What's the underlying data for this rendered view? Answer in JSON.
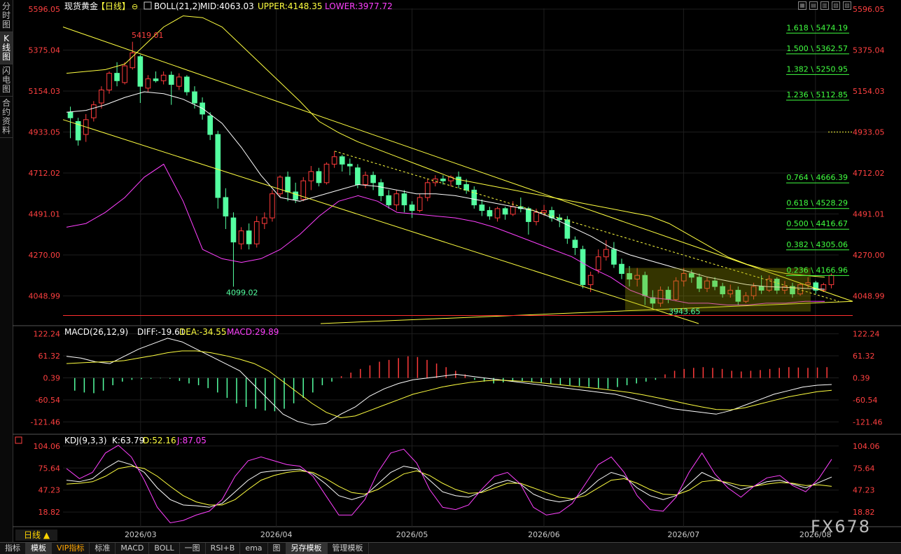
{
  "sidebar": {
    "tabs": [
      {
        "label": "分时图",
        "active": false
      },
      {
        "label": "K线图",
        "active": true
      },
      {
        "label": "闪电图",
        "active": false
      },
      {
        "label": "合约资料",
        "active": false
      }
    ]
  },
  "header": {
    "title": "现货黄金",
    "period": "【日线】",
    "lock_glyph": "⊖",
    "boll_label": "BOLL(21,2)",
    "mid_text": "MID:4063.03",
    "upper_text": "UPPER:4148.35",
    "lower_text": "LOWER:3977.72"
  },
  "macd_header": {
    "label": "MACD(26,12,9)",
    "diff": "DIFF:-19.61",
    "dea": "DEA:-34.55",
    "macd": "MACD:29.89"
  },
  "kdj_header": {
    "label": "KDJ(9,3,3)",
    "k": "K:63.79",
    "d": "D:52.16",
    "j": "J:87.05"
  },
  "period_button": "日线 ▲",
  "watermark": "FX678",
  "bottom_tabs": [
    {
      "label": "指标",
      "active": false,
      "vip": false
    },
    {
      "label": "模板",
      "active": true,
      "vip": false
    },
    {
      "label": "VIP指标",
      "active": false,
      "vip": true
    },
    {
      "label": "标准",
      "active": false,
      "vip": false
    },
    {
      "label": "MACD",
      "active": false,
      "vip": false
    },
    {
      "label": "BOLL",
      "active": false,
      "vip": false
    },
    {
      "label": "一图",
      "active": false,
      "vip": false
    },
    {
      "label": "RSI+B",
      "active": false,
      "vip": false
    },
    {
      "label": "ema",
      "active": false,
      "vip": false
    },
    {
      "label": "图",
      "active": false,
      "vip": false
    },
    {
      "label": "另存模板",
      "active": true,
      "vip": false
    },
    {
      "label": "管理模板",
      "active": false,
      "vip": false
    }
  ],
  "colors": {
    "up": "#ff3b3b",
    "down": "#54ffa0",
    "boll_mid": "#ffffff",
    "boll_upper": "#ffff40",
    "boll_lower": "#ff40ff",
    "channel": "#ffff40",
    "grid": "#1e1e1e",
    "axis": "#ff4040",
    "fib": "#40ff40"
  },
  "chart_data": [
    {
      "type": "candlestick",
      "title": "现货黄金【日线】",
      "y_ticks": [
        "5596.05",
        "5375.04",
        "5154.03",
        "4933.05",
        "4712.02",
        "4491.01",
        "4270.00",
        "4048.99"
      ],
      "ylim": [
        3900,
        5600
      ],
      "x_ticks": [
        "2026/03",
        "2026/04",
        "2026/05",
        "2026/06",
        "2026/07",
        "2026/08"
      ],
      "candles": [
        [
          5040,
          5010,
          5070,
          4900
        ],
        [
          4990,
          4890,
          5010,
          4860
        ],
        [
          4920,
          5000,
          5030,
          4880
        ],
        [
          5010,
          5080,
          5100,
          4990
        ],
        [
          5090,
          5160,
          5180,
          5060
        ],
        [
          5160,
          5250,
          5260,
          5140
        ],
        [
          5250,
          5210,
          5310,
          5180
        ],
        [
          5200,
          5290,
          5310,
          5190
        ],
        [
          5280,
          5360,
          5420,
          5270
        ],
        [
          5340,
          5180,
          5350,
          5090
        ],
        [
          5170,
          5220,
          5240,
          5150
        ],
        [
          5220,
          5210,
          5260,
          5200
        ],
        [
          5210,
          5240,
          5260,
          5190
        ],
        [
          5240,
          5190,
          5260,
          5080
        ],
        [
          5180,
          5230,
          5250,
          5160
        ],
        [
          5230,
          5150,
          5240,
          5130
        ],
        [
          5150,
          5090,
          5180,
          5060
        ],
        [
          5090,
          5030,
          5120,
          5000
        ],
        [
          5020,
          4920,
          5040,
          4890
        ],
        [
          4920,
          4580,
          4940,
          4520
        ],
        [
          4580,
          4480,
          4630,
          4410
        ],
        [
          4470,
          4340,
          4500,
          4099
        ],
        [
          4330,
          4400,
          4420,
          4300
        ],
        [
          4400,
          4330,
          4440,
          4300
        ],
        [
          4330,
          4450,
          4480,
          4310
        ],
        [
          4440,
          4470,
          4500,
          4410
        ],
        [
          4470,
          4600,
          4620,
          4450
        ],
        [
          4600,
          4690,
          4700,
          4580
        ],
        [
          4690,
          4610,
          4720,
          4560
        ],
        [
          4610,
          4570,
          4660,
          4550
        ],
        [
          4570,
          4670,
          4690,
          4560
        ],
        [
          4670,
          4720,
          4750,
          4620
        ],
        [
          4720,
          4660,
          4740,
          4640
        ],
        [
          4660,
          4760,
          4770,
          4650
        ],
        [
          4760,
          4800,
          4830,
          4740
        ],
        [
          4800,
          4760,
          4810,
          4720
        ],
        [
          4760,
          4750,
          4790,
          4700
        ],
        [
          4740,
          4650,
          4760,
          4630
        ],
        [
          4650,
          4700,
          4720,
          4630
        ],
        [
          4700,
          4660,
          4720,
          4620
        ],
        [
          4660,
          4590,
          4680,
          4560
        ],
        [
          4590,
          4540,
          4620,
          4520
        ],
        [
          4540,
          4600,
          4620,
          4510
        ],
        [
          4600,
          4540,
          4620,
          4500
        ],
        [
          4540,
          4510,
          4560,
          4470
        ],
        [
          4510,
          4580,
          4600,
          4500
        ],
        [
          4580,
          4660,
          4680,
          4560
        ],
        [
          4660,
          4680,
          4700,
          4640
        ],
        [
          4680,
          4670,
          4700,
          4650
        ],
        [
          4670,
          4690,
          4700,
          4640
        ],
        [
          4690,
          4650,
          4720,
          4630
        ],
        [
          4650,
          4620,
          4680,
          4600
        ],
        [
          4620,
          4540,
          4640,
          4520
        ],
        [
          4540,
          4510,
          4570,
          4480
        ],
        [
          4510,
          4480,
          4530,
          4460
        ],
        [
          4470,
          4520,
          4530,
          4450
        ],
        [
          4520,
          4490,
          4530,
          4460
        ],
        [
          4490,
          4530,
          4560,
          4480
        ],
        [
          4530,
          4520,
          4580,
          4500
        ],
        [
          4520,
          4450,
          4530,
          4380
        ],
        [
          4450,
          4500,
          4520,
          4430
        ],
        [
          4500,
          4510,
          4540,
          4480
        ],
        [
          4510,
          4470,
          4530,
          4450
        ],
        [
          4470,
          4460,
          4490,
          4420
        ],
        [
          4460,
          4360,
          4480,
          4330
        ],
        [
          4350,
          4310,
          4370,
          4270
        ],
        [
          4300,
          4110,
          4320,
          4090
        ],
        [
          4110,
          4160,
          4180,
          4070
        ],
        [
          4190,
          4260,
          4300,
          4170
        ],
        [
          4260,
          4300,
          4350,
          4240
        ],
        [
          4300,
          4220,
          4340,
          4200
        ],
        [
          4220,
          4170,
          4250,
          4140
        ],
        [
          4170,
          4140,
          4210,
          4100
        ],
        [
          4140,
          4160,
          4200,
          4100
        ],
        [
          4160,
          4050,
          4180,
          4000
        ],
        [
          4040,
          4010,
          4080,
          3980
        ],
        [
          4010,
          4080,
          4100,
          3990
        ],
        [
          4080,
          4030,
          4100,
          4010
        ],
        [
          4030,
          4130,
          4150,
          4020
        ],
        [
          4130,
          4170,
          4200,
          4100
        ],
        [
          4170,
          4150,
          4190,
          4120
        ],
        [
          4150,
          4090,
          4170,
          4070
        ],
        [
          4090,
          4130,
          4150,
          4070
        ],
        [
          4130,
          4100,
          4150,
          4080
        ],
        [
          4100,
          4060,
          4120,
          4040
        ],
        [
          4060,
          4080,
          4110,
          4040
        ],
        [
          4080,
          4020,
          4100,
          4000
        ],
        [
          4020,
          4050,
          4070,
          4010
        ],
        [
          4050,
          4100,
          4120,
          4030
        ],
        [
          4100,
          4080,
          4160,
          4060
        ],
        [
          4080,
          4140,
          4160,
          4070
        ],
        [
          4140,
          4080,
          4150,
          4060
        ],
        [
          4080,
          4100,
          4130,
          4060
        ],
        [
          4100,
          4060,
          4120,
          4040
        ],
        [
          4060,
          4110,
          4120,
          4050
        ],
        [
          4110,
          4120,
          4150,
          4090
        ],
        [
          4120,
          4080,
          4130,
          4060
        ],
        [
          4080,
          4110,
          4120,
          4070
        ],
        [
          4110,
          4160,
          4170,
          4090
        ]
      ],
      "boll_upper": [
        5250,
        5260,
        5270,
        5300,
        5400,
        5500,
        5560,
        5550,
        5500,
        5400,
        5300,
        5200,
        5100,
        4990,
        4930,
        4880,
        4840,
        4800,
        4760,
        4720,
        4680,
        4660,
        4640,
        4620,
        4600,
        4580,
        4560,
        4540,
        4520,
        4500,
        4480,
        4440,
        4380,
        4320,
        4260,
        4220,
        4190,
        4170,
        4160,
        4150
      ],
      "boll_mid": [
        5040,
        5050,
        5080,
        5120,
        5150,
        5140,
        5110,
        5060,
        4980,
        4850,
        4700,
        4580,
        4560,
        4590,
        4620,
        4650,
        4640,
        4620,
        4600,
        4600,
        4590,
        4570,
        4550,
        4530,
        4510,
        4470,
        4420,
        4370,
        4310,
        4270,
        4240,
        4210,
        4180,
        4150,
        4130,
        4110,
        4100,
        4095,
        4090,
        4085
      ],
      "boll_lower": [
        4420,
        4440,
        4500,
        4580,
        4690,
        4760,
        4560,
        4300,
        4250,
        4230,
        4250,
        4300,
        4380,
        4480,
        4560,
        4590,
        4560,
        4500,
        4490,
        4480,
        4470,
        4450,
        4420,
        4380,
        4340,
        4300,
        4260,
        4200,
        4150,
        4080,
        4040,
        4030,
        4010,
        4010,
        4000,
        4000,
        4010,
        4010,
        4020,
        4020
      ],
      "fib_levels": [
        {
          "label": "1.618 \\ 5474.19",
          "value": 5474.19
        },
        {
          "label": "1.500 \\ 5362.57",
          "value": 5362.57
        },
        {
          "label": "1.382 \\ 5250.95",
          "value": 5250.95
        },
        {
          "label": "1.236 \\ 5112.85",
          "value": 5112.85
        },
        {
          "label": "0.764 \\ 4666.39",
          "value": 4666.39
        },
        {
          "label": "0.618 \\ 4528.29",
          "value": 4528.29
        },
        {
          "label": "0.500 \\ 4416.67",
          "value": 4416.67
        },
        {
          "label": "0.382 \\ 4305.06",
          "value": 4305.06
        },
        {
          "label": "0.236 \\ 4166.96",
          "value": 4166.96
        }
      ],
      "annotations": [
        {
          "text": "5419.01",
          "value": 5419.01
        },
        {
          "text": "4099.02",
          "value": 4099.02
        },
        {
          "text": "3943.65",
          "value": 3943.65
        }
      ],
      "support_line_value": 3943.65
    },
    {
      "type": "macd",
      "y_ticks": [
        "122.24",
        "61.32",
        "0.39",
        "-60.54",
        "-121.46"
      ],
      "ylim": [
        -140,
        135
      ],
      "diff": [
        60,
        55,
        45,
        40,
        60,
        80,
        95,
        110,
        100,
        80,
        60,
        40,
        20,
        -20,
        -60,
        -100,
        -120,
        -130,
        -125,
        -100,
        -80,
        -50,
        -30,
        -15,
        -5,
        0,
        5,
        10,
        5,
        0,
        -5,
        -10,
        -15,
        -20,
        -25,
        -30,
        -35,
        -40,
        -45,
        -55,
        -65,
        -75,
        -85,
        -90,
        -95,
        -100,
        -90,
        -75,
        -60,
        -45,
        -35,
        -25,
        -20,
        -18
      ],
      "dea": [
        40,
        42,
        44,
        45,
        48,
        55,
        62,
        70,
        75,
        75,
        70,
        62,
        52,
        40,
        20,
        -10,
        -40,
        -70,
        -95,
        -110,
        -105,
        -90,
        -75,
        -60,
        -45,
        -35,
        -25,
        -18,
        -12,
        -8,
        -6,
        -8,
        -10,
        -14,
        -18,
        -22,
        -26,
        -30,
        -35,
        -40,
        -47,
        -55,
        -63,
        -72,
        -80,
        -87,
        -88,
        -82,
        -72,
        -62,
        -52,
        -45,
        -38,
        -34
      ],
      "hist": [
        -35,
        -40,
        -42,
        -35,
        -20,
        -10,
        -5,
        -3,
        -2,
        -1,
        -2,
        -8,
        -15,
        -20,
        -28,
        -40,
        -55,
        -70,
        -80,
        -85,
        -90,
        -92,
        -85,
        -70,
        -55,
        -40,
        -20,
        -10,
        5,
        15,
        25,
        35,
        45,
        50,
        55,
        60,
        58,
        50,
        40,
        30,
        20,
        10,
        -5,
        -10,
        -15,
        -12,
        -10,
        -8,
        -10,
        -12,
        -15,
        -18,
        -20,
        -22,
        -25,
        -28,
        -30,
        -25,
        -20,
        -15,
        -10,
        -5,
        10,
        20,
        25,
        28,
        30,
        28,
        25,
        20,
        18,
        20,
        22,
        25,
        28,
        30,
        29,
        28,
        29,
        30
      ]
    },
    {
      "type": "kdj",
      "y_ticks": [
        "104.06",
        "75.64",
        "47.23",
        "18.82"
      ],
      "ylim": [
        0,
        112
      ],
      "k": [
        60,
        58,
        62,
        75,
        85,
        80,
        70,
        50,
        35,
        28,
        27,
        25,
        30,
        45,
        60,
        70,
        72,
        73,
        74,
        68,
        55,
        40,
        35,
        40,
        55,
        70,
        78,
        75,
        60,
        45,
        40,
        38,
        45,
        55,
        60,
        55,
        42,
        35,
        32,
        35,
        45,
        60,
        70,
        65,
        50,
        40,
        35,
        40,
        55,
        70,
        62,
        55,
        48,
        52,
        58,
        60,
        55,
        50,
        57,
        64
      ],
      "d": [
        55,
        56,
        58,
        65,
        75,
        78,
        75,
        65,
        52,
        40,
        32,
        28,
        28,
        35,
        48,
        60,
        66,
        70,
        72,
        70,
        62,
        52,
        44,
        42,
        48,
        58,
        68,
        72,
        66,
        56,
        48,
        43,
        44,
        50,
        56,
        56,
        50,
        44,
        38,
        36,
        40,
        50,
        60,
        62,
        56,
        48,
        42,
        41,
        47,
        58,
        60,
        57,
        53,
        52,
        55,
        57,
        56,
        53,
        54,
        52
      ],
      "j": [
        75,
        62,
        70,
        95,
        105,
        90,
        60,
        25,
        5,
        8,
        15,
        20,
        35,
        65,
        85,
        90,
        85,
        80,
        78,
        65,
        40,
        15,
        15,
        35,
        70,
        95,
        100,
        82,
        48,
        25,
        22,
        28,
        48,
        65,
        70,
        55,
        25,
        15,
        18,
        30,
        55,
        80,
        90,
        70,
        40,
        22,
        20,
        38,
        70,
        95,
        68,
        50,
        38,
        52,
        63,
        66,
        53,
        45,
        62,
        87
      ]
    }
  ]
}
